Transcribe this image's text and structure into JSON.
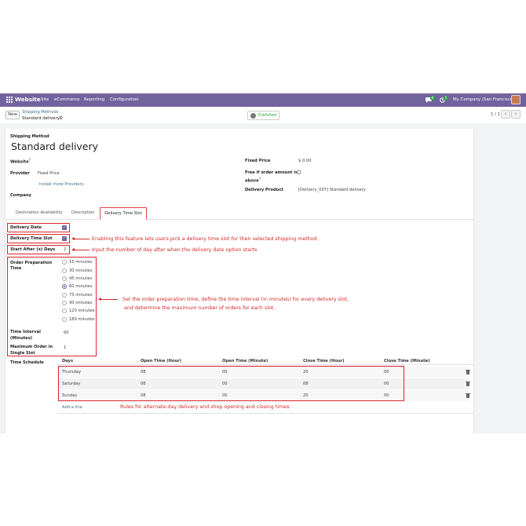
{
  "navbar": {
    "app": "Website",
    "menu": [
      "Site",
      "eCommerce",
      "Reporting",
      "Configuration"
    ],
    "chat_badge": "6",
    "activity_badge": "5",
    "company": "My Company (San Francisco)"
  },
  "control": {
    "new_label": "New",
    "breadcrumb_parent": "Shipping Methods",
    "breadcrumb_current": "Standard delivery",
    "published_label": "Published",
    "pager": "1 / 1"
  },
  "form": {
    "title_label": "Shipping Method",
    "title": "Standard delivery",
    "website_label": "Website",
    "provider_label": "Provider",
    "provider_value": "Fixed Price",
    "install_link": "Install more Providers",
    "company_label": "Company",
    "fixed_price_label": "Fixed Price",
    "fixed_price_value": "$ 0.00",
    "free_label_1": "Free if order amount is",
    "free_label_2": "above",
    "delivery_product_label": "Delivery Product",
    "delivery_product_value": "[Delivery_007] Standard delivery"
  },
  "tabs": [
    "Destination Availability",
    "Description",
    "Delivery Time Slot"
  ],
  "slot": {
    "delivery_date_label": "Delivery Date",
    "delivery_time_slot_label": "Delivery Time Slot",
    "start_after_label": "Start After (x) Days",
    "start_after_value": "2",
    "prep_label_1": "Order Preparation",
    "prep_label_2": "Time",
    "prep_options": [
      "15 minutes",
      "30 minutes",
      "45 minutes",
      "60 minutes",
      "75 minutes",
      "90 minutes",
      "120 minutes",
      "180 minutes"
    ],
    "prep_selected": "60 minutes",
    "interval_label_1": "Time Interval",
    "interval_label_2": "(Minutes)",
    "interval_value": "60",
    "max_orders_label_1": "Maximum Order in",
    "max_orders_label_2": "Single Slot",
    "max_orders_value": "1",
    "schedule_label": "Time Schedule"
  },
  "schedule": {
    "headers": [
      "Days",
      "Open Time (Hour)",
      "Open Time (Minute)",
      "Close Time (Hour)",
      "Close Time (Minute)"
    ],
    "rows": [
      [
        "Thursday",
        "08",
        "00",
        "20",
        "00"
      ],
      [
        "Saturday",
        "08",
        "00",
        "08",
        "00"
      ],
      [
        "Sunday",
        "08",
        "00",
        "20",
        "00"
      ]
    ],
    "add_line": "Add a line"
  },
  "annotations": {
    "time_slot": "Enabling this feature lets users pick a delivery time slot for their selected shipping method.",
    "start_after": "Input the number of day  after when the delivery date option starts",
    "prep_1": "Set the order preparation time, define the time interval (in minutes) for every delivery slot,",
    "prep_2": "and determine the maximum number of orders for each slot.",
    "rules": "Rules for alternate-day delivery and shop opening and closing times."
  },
  "colors": {
    "navbar": "#71639e",
    "accent": "#6f5f9a",
    "annotation": "#d12a2a",
    "published": "#28a745"
  }
}
